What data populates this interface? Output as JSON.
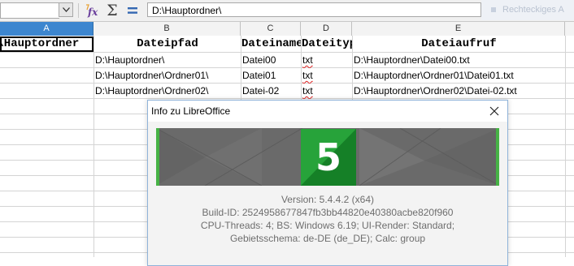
{
  "formula_bar": {
    "name_box_value": "",
    "formula_text": "D:\\Hauptordner\\",
    "shape_hint": "Rechteckiges A",
    "function_wizard_icon": "function-wizard-icon",
    "sum_icon": "sum-icon",
    "formula_icon": "equals-icon"
  },
  "sheet": {
    "columns": [
      "A",
      "B",
      "C",
      "D",
      "E"
    ],
    "active_column": "A",
    "active_cell_text": ":\\Hauptordner",
    "header_row": [
      "D:\\Hauptordner",
      "Dateipfad",
      "Dateiname",
      "Dateityp",
      "Dateiaufruf"
    ],
    "rows": [
      [
        "",
        "D:\\Hauptordner\\",
        "Datei00",
        "txt",
        "D:\\Hauptordner\\Datei00.txt"
      ],
      [
        "",
        "D:\\Hauptordner\\Ordner01\\",
        "Datei01",
        "txt",
        "D:\\Hauptordner\\Ordner01\\Datei01.txt"
      ],
      [
        "",
        "D:\\Hauptordner\\Ordner02\\",
        "Datei-02",
        "txt",
        "D:\\Hauptordner\\Ordner02\\Datei-02.txt"
      ]
    ]
  },
  "dialog": {
    "title": "Info zu LibreOffice",
    "close_icon": "close-icon",
    "version_badge": "5",
    "info_lines": [
      "Version: 5.4.4.2 (x64)",
      "Build-ID: 2524958677847fb3bb44820e40380acbe820f960",
      "CPU-Threads: 4; BS: Windows 6.19; UI-Render: Standard;",
      "Gebietsschema: de-DE (de_DE); Calc: group"
    ]
  },
  "colors": {
    "accent_header": "#3d86cf",
    "badge_green": "#1a8b2e",
    "banner_gray": "#6a6a6a",
    "banner_edge_green": "#46b245"
  }
}
